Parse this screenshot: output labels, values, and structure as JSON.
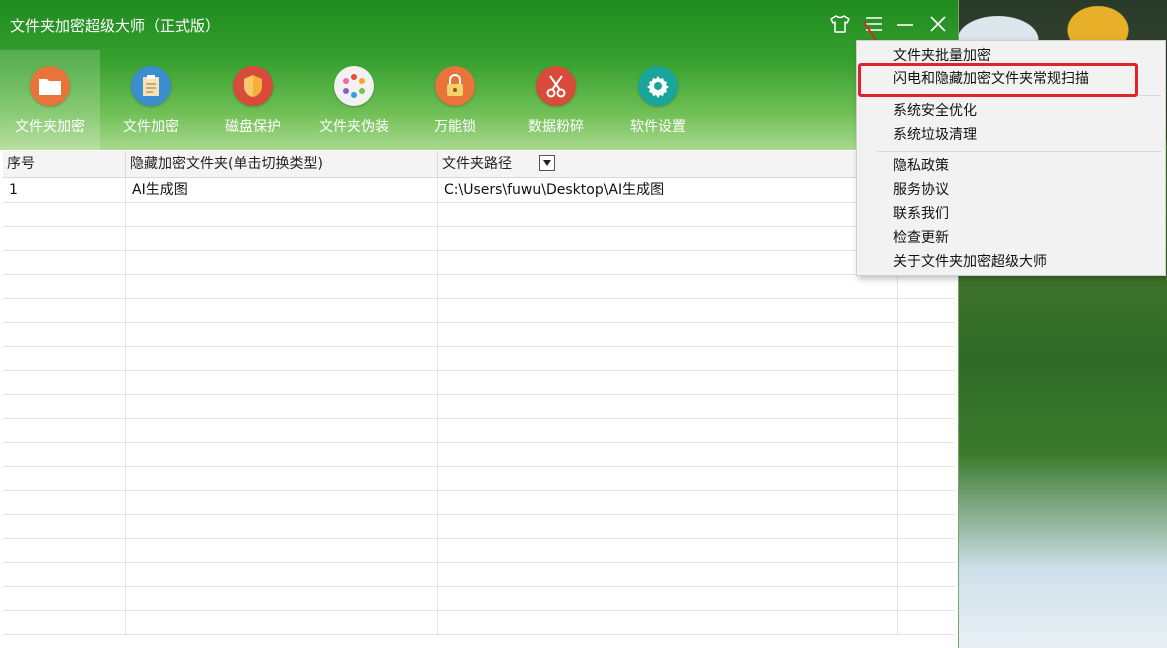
{
  "window": {
    "title": "文件夹加密超级大师（正式版）"
  },
  "toolbar": [
    {
      "label": "文件夹加密",
      "icon": "folder-icon",
      "color": "#e8743a",
      "active": true
    },
    {
      "label": "文件加密",
      "icon": "document-icon",
      "color": "#3b8fd1"
    },
    {
      "label": "磁盘保护",
      "icon": "shield-icon",
      "color": "#d94a3a"
    },
    {
      "label": "文件夹伪装",
      "icon": "palette-icon",
      "color": "#f1f1f1"
    },
    {
      "label": "万能锁",
      "icon": "lock-icon",
      "color": "#e8743a"
    },
    {
      "label": "数据粉碎",
      "icon": "scissors-icon",
      "color": "#d94a3a"
    },
    {
      "label": "软件设置",
      "icon": "gear-icon",
      "color": "#1aa59a"
    }
  ],
  "table": {
    "columns": [
      "序号",
      "隐藏加密文件夹(单击切换类型)",
      "文件夹路径"
    ],
    "rows": [
      [
        "1",
        "AI生成图",
        "C:\\Users\\fuwu\\Desktop\\AI生成图"
      ]
    ]
  },
  "menu": {
    "items": [
      "文件夹批量加密",
      "闪电和隐藏加密文件夹常规扫描",
      "系统安全优化",
      "系统垃圾清理",
      "隐私政策",
      "服务协议",
      "联系我们",
      "检查更新",
      "关于文件夹加密超级大师"
    ],
    "highlight_color": "#e0232b"
  }
}
